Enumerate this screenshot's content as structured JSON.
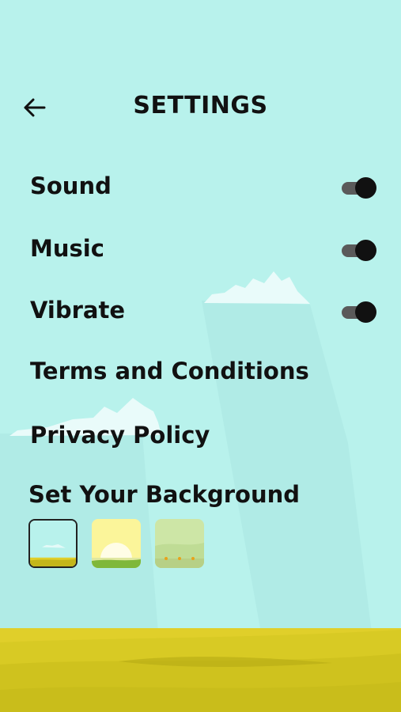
{
  "header": {
    "title": "SETTINGS",
    "back_icon": "arrow-left-icon"
  },
  "settings": [
    {
      "label": "Sound",
      "on": true
    },
    {
      "label": "Music",
      "on": true
    },
    {
      "label": "Vibrate",
      "on": true
    }
  ],
  "links": {
    "terms": "Terms and Conditions",
    "privacy": "Privacy Policy"
  },
  "background": {
    "title": "Set Your Background",
    "options": [
      {
        "name": "sky",
        "selected": true
      },
      {
        "name": "sunrise",
        "selected": false
      },
      {
        "name": "meadow",
        "selected": false
      }
    ]
  },
  "colors": {
    "sky": "#b8f2ec",
    "ground": "#e0cf2a",
    "toggle_track": "#5a5a5a",
    "toggle_knob": "#111111"
  }
}
